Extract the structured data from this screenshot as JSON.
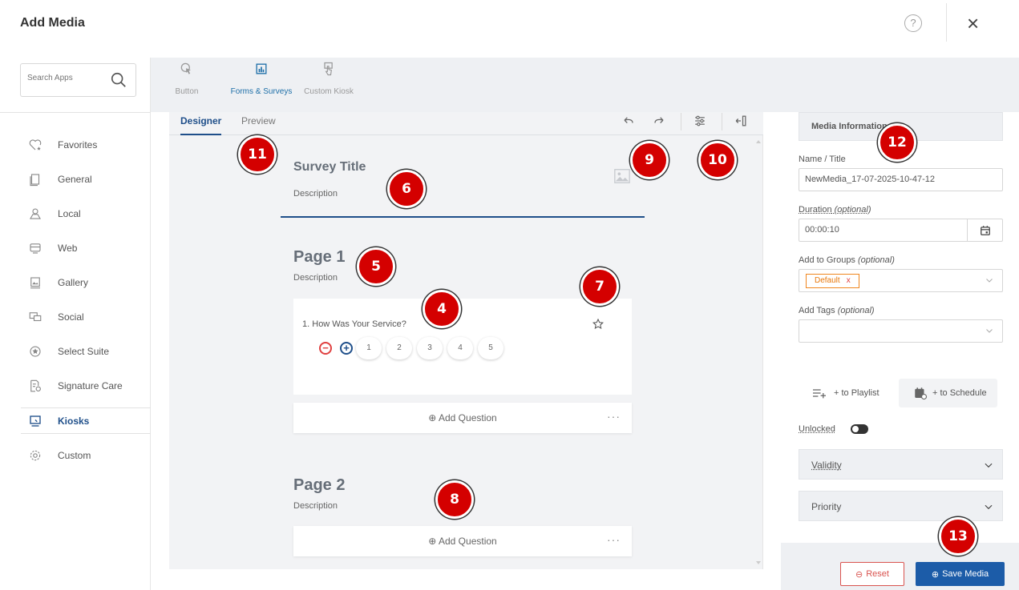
{
  "header": {
    "title": "Add Media",
    "help_icon": "question-circle-icon",
    "close_label": "×"
  },
  "search": {
    "placeholder": "Search Apps"
  },
  "sidebar": {
    "items": [
      {
        "label": "Favorites",
        "icon": "heart-star-icon"
      },
      {
        "label": "General",
        "icon": "document-icon"
      },
      {
        "label": "Local",
        "icon": "map-pin-icon"
      },
      {
        "label": "Web",
        "icon": "web-icon"
      },
      {
        "label": "Gallery",
        "icon": "gallery-icon"
      },
      {
        "label": "Social",
        "icon": "chat-icon"
      },
      {
        "label": "Select Suite",
        "icon": "star-circle-icon"
      },
      {
        "label": "Signature Care",
        "icon": "signature-icon"
      },
      {
        "label": "Kiosks",
        "icon": "kiosk-icon",
        "active": true
      },
      {
        "label": "Custom",
        "icon": "gear-icon"
      }
    ]
  },
  "app_tabs": [
    {
      "label": "Button",
      "icon": "touch-icon"
    },
    {
      "label": "Forms & Surveys",
      "icon": "chart-icon",
      "active": true
    },
    {
      "label": "Custom Kiosk",
      "icon": "kiosk-touch-icon"
    }
  ],
  "designer": {
    "tabs": [
      {
        "label": "Designer",
        "active": true
      },
      {
        "label": "Preview"
      }
    ],
    "toolbar": [
      "undo-icon",
      "redo-icon",
      "settings-sliders-icon",
      "collapse-panel-icon"
    ]
  },
  "survey": {
    "title": "Survey Title",
    "description": "Description",
    "pages": [
      {
        "title": "Page 1",
        "description": "Description",
        "questions": [
          {
            "number": "1.",
            "text": "How Was Your Service?",
            "ratings": [
              "1",
              "2",
              "3",
              "4",
              "5"
            ]
          }
        ],
        "add_question": "Add Question"
      },
      {
        "title": "Page 2",
        "description": "Description",
        "add_question": "Add Question"
      }
    ]
  },
  "media_info": {
    "section_label": "Media Information",
    "name_label": "Name / Title",
    "name_value": "NewMedia_17-07-2025-10-47-12",
    "duration_label": "Duration",
    "duration_optional": "(optional)",
    "duration_value": "00:00:10",
    "groups_label": "Add to Groups",
    "groups_optional": "(optional)",
    "groups_chip": "Default",
    "groups_chip_remove": "x",
    "tags_label": "Add Tags",
    "tags_optional": "(optional)",
    "playlist_btn": "+ to Playlist",
    "schedule_btn": "+ to Schedule",
    "unlocked_label": "Unlocked",
    "validity_label": "Validity",
    "priority_label": "Priority"
  },
  "footer": {
    "reset_label": "Reset",
    "save_label": "Save Media"
  },
  "markers": [
    "11",
    "6",
    "9",
    "10",
    "12",
    "5",
    "7",
    "4",
    "8",
    "13"
  ],
  "colors": {
    "accent": "#1f4f8a",
    "save": "#1c5ca8",
    "danger": "#d9534f",
    "chip": "#f0861e",
    "marker": "#d40000"
  }
}
